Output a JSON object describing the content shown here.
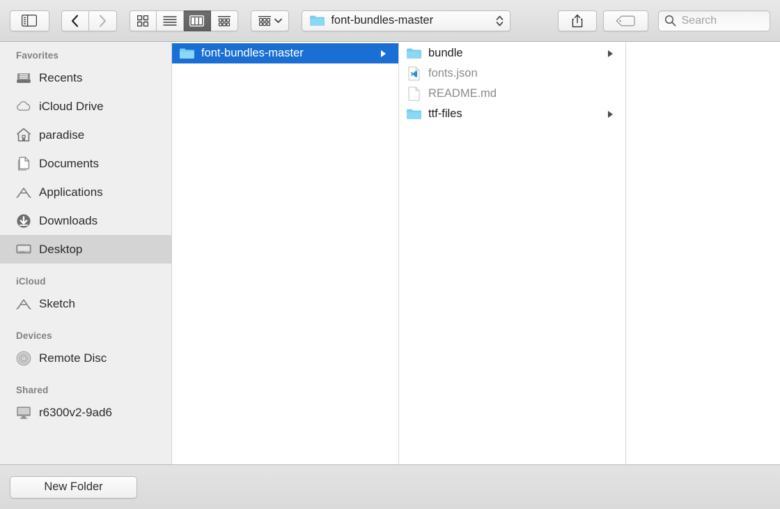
{
  "window": {
    "title": "font-bundles-master"
  },
  "toolbar": {
    "sidebar_toggle": {
      "icon": "sidebar-toggle-icon",
      "tooltip": "Hide Sidebar"
    },
    "back": {
      "icon": "chevron-left-icon",
      "label": "Back",
      "enabled": true
    },
    "forward": {
      "icon": "chevron-right-icon",
      "label": "Forward",
      "enabled": false
    },
    "view_modes": [
      {
        "id": "icon",
        "icon": "grid-view-icon",
        "label": "as Icons",
        "active": false
      },
      {
        "id": "list",
        "icon": "list-view-icon",
        "label": "as List",
        "active": false
      },
      {
        "id": "column",
        "icon": "column-view-icon",
        "label": "as Columns",
        "active": true
      },
      {
        "id": "gallery",
        "icon": "gallery-view-icon",
        "label": "as Gallery",
        "active": false
      }
    ],
    "arrange": {
      "icon": "arrange-icon",
      "chevron": "chevron-down-icon",
      "label": "Arrange"
    },
    "path_select": {
      "icon": "folder-icon",
      "value": "font-bundles-master",
      "stepper": "up-down-stepper-icon"
    },
    "share": {
      "icon": "share-icon",
      "label": "Share"
    },
    "tags": {
      "icon": "tag-icon",
      "label": "Edit Tags"
    },
    "search": {
      "icon": "search-icon",
      "placeholder": "Search",
      "value": ""
    }
  },
  "sidebar": {
    "sections": [
      {
        "title": "Favorites",
        "items": [
          {
            "label": "Recents",
            "icon": "recents-icon",
            "selected": false
          },
          {
            "label": "iCloud Drive",
            "icon": "cloud-icon",
            "selected": false
          },
          {
            "label": "paradise",
            "icon": "home-icon",
            "selected": false
          },
          {
            "label": "Documents",
            "icon": "documents-icon",
            "selected": false
          },
          {
            "label": "Applications",
            "icon": "applications-icon",
            "selected": false
          },
          {
            "label": "Downloads",
            "icon": "downloads-icon",
            "selected": false
          },
          {
            "label": "Desktop",
            "icon": "desktop-icon",
            "selected": true
          }
        ]
      },
      {
        "title": "iCloud",
        "items": [
          {
            "label": "Sketch",
            "icon": "applications-icon",
            "selected": false
          }
        ]
      },
      {
        "title": "Devices",
        "items": [
          {
            "label": "Remote Disc",
            "icon": "disc-icon",
            "selected": false
          }
        ]
      },
      {
        "title": "Shared",
        "items": [
          {
            "label": "r6300v2-9ad6",
            "icon": "display-icon",
            "selected": false
          }
        ]
      }
    ]
  },
  "columns": [
    {
      "id": "column-1",
      "items": [
        {
          "name": "font-bundles-master",
          "icon": "folder-icon",
          "selected": true,
          "has_children": true,
          "dim": false
        }
      ]
    },
    {
      "id": "column-2",
      "items": [
        {
          "name": "bundle",
          "icon": "folder-icon",
          "selected": false,
          "has_children": true,
          "dim": false
        },
        {
          "name": "fonts.json",
          "icon": "vscode-file-icon",
          "selected": false,
          "has_children": false,
          "dim": true
        },
        {
          "name": "README.md",
          "icon": "blank-file-icon",
          "selected": false,
          "has_children": false,
          "dim": true
        },
        {
          "name": "ttf-files",
          "icon": "folder-icon",
          "selected": false,
          "has_children": true,
          "dim": false
        }
      ]
    },
    {
      "id": "column-3",
      "items": []
    }
  ],
  "bottombar": {
    "new_folder_label": "New Folder"
  },
  "colors": {
    "selection_blue": "#1a6fd4",
    "folder_blue": "#6fc8f2",
    "sidebar_bg": "#efefef",
    "sidebar_selected": "#d4d4d4",
    "toolbar_top": "#e9e9e9",
    "toolbar_bottom": "#d9d9d9",
    "dim_text": "#8b8b8b"
  }
}
